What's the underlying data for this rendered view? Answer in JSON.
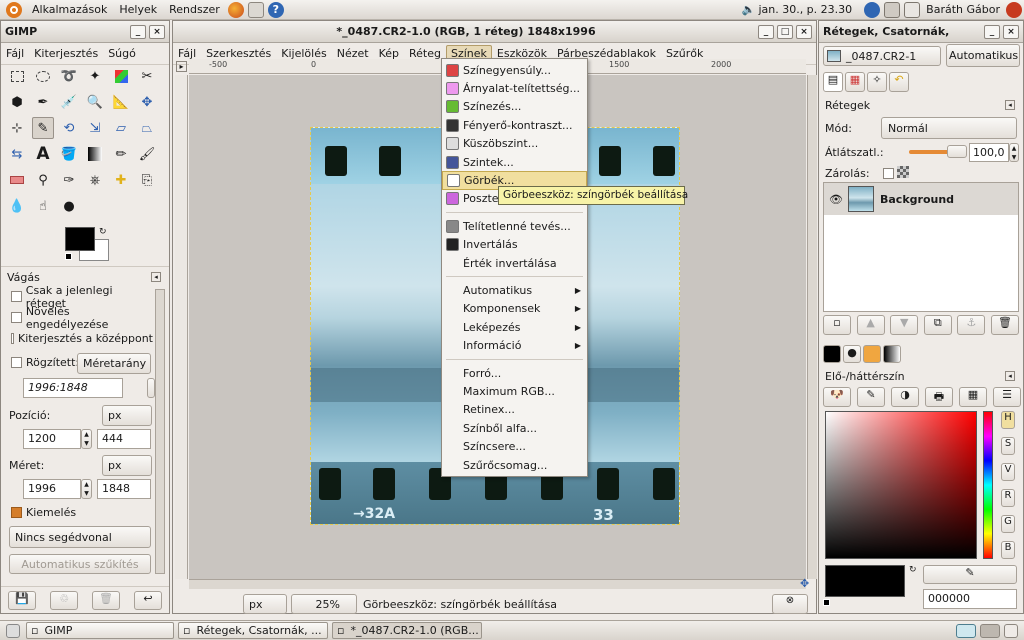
{
  "top_panel": {
    "menus": [
      "Alkalmazások",
      "Helyek",
      "Rendszer"
    ],
    "clock": "jan. 30., p. 23.30",
    "user": "Baráth Gábor"
  },
  "toolbox": {
    "title": "GIMP",
    "menu": [
      "Fájl",
      "Kiterjesztés",
      "Súgó"
    ],
    "options_title": "Vágás",
    "opt_current_layer": "Csak a jelenlegi réteget",
    "opt_allow_grow": "Növelés engedélyezése",
    "opt_from_center": "Kiterjesztés a középpont",
    "opt_fixed": "Rögzített:",
    "fixed_mode": "Méretarány",
    "ratio_value": "1996:1848",
    "position_label": "Pozíció:",
    "position_unit": "px",
    "pos_x": "1200",
    "pos_y": "444",
    "size_label": "Méret:",
    "size_unit": "px",
    "size_w": "1996",
    "size_h": "1848",
    "opt_highlight": "Kiemelés",
    "guides": "Nincs segédvonal",
    "auto_shrink": "Automatikus szűkítés"
  },
  "image_window": {
    "title": "*_0487.CR2-1.0 (RGB, 1 réteg) 1848x1996",
    "menu": [
      "Fájl",
      "Szerkesztés",
      "Kijelölés",
      "Nézet",
      "Kép",
      "Réteg",
      "Színek",
      "Eszközök",
      "Párbeszédablakok",
      "Szűrők"
    ],
    "active_menu_index": 6,
    "ruler_marks": [
      "-500",
      "0",
      "1500",
      "2000"
    ],
    "status_unit": "px",
    "zoom": "25%",
    "status_text": "Görbeeszköz: színgörbék beállítása",
    "film_label_left": "→32A",
    "film_label_right": "33"
  },
  "colors_menu": {
    "items": [
      {
        "label": "Színegyensúly...",
        "icon": "color-balance-icon"
      },
      {
        "label": "Árnyalat-telítettség...",
        "icon": "hue-saturation-icon"
      },
      {
        "label": "Színezés...",
        "icon": "colorize-icon"
      },
      {
        "label": "Fényerő-kontraszt...",
        "icon": "brightness-contrast-icon"
      },
      {
        "label": "Küszöbszint...",
        "icon": "threshold-icon"
      },
      {
        "label": "Szintek...",
        "icon": "levels-icon"
      },
      {
        "label": "Görbék...",
        "icon": "curves-icon",
        "highlighted": true
      },
      {
        "label": "Poszterizálás...",
        "icon": "posterize-icon"
      }
    ],
    "items2": [
      {
        "label": "Telítetlenné tevés...",
        "icon": "desaturate-icon"
      },
      {
        "label": "Invertálás",
        "icon": "invert-icon"
      },
      {
        "label": "Érték invertálása",
        "icon": ""
      }
    ],
    "submenus": [
      "Automatikus",
      "Komponensek",
      "Leképezés",
      "Információ"
    ],
    "items3": [
      "Forró...",
      "Maximum RGB...",
      "Retinex...",
      "Színből alfa...",
      "Színcsere...",
      "Szűrőcsomag..."
    ],
    "tooltip": "Görbeeszköz: színgörbék beállítása"
  },
  "layers_window": {
    "title": "Rétegek, Csatornák,",
    "image_name": "_0487.CR2-1",
    "auto_button": "Automatikus",
    "layers_label": "Rétegek",
    "mode_label": "Mód:",
    "mode_value": "Normál",
    "opacity_label": "Átlátszatl.:",
    "opacity_value": "100,0",
    "opacity_fraction": 1.0,
    "lock_label": "Zárolás:",
    "layer_name": "Background",
    "fgbg_label": "Elő-/háttérszín",
    "channel_letters": [
      "H",
      "S",
      "V",
      "R",
      "G",
      "B"
    ],
    "hex_value": "000000"
  },
  "taskbar": {
    "tasks": [
      "GIMP",
      "Rétegek, Csatornák, ...",
      "*_0487.CR2-1.0 (RGB..."
    ]
  }
}
